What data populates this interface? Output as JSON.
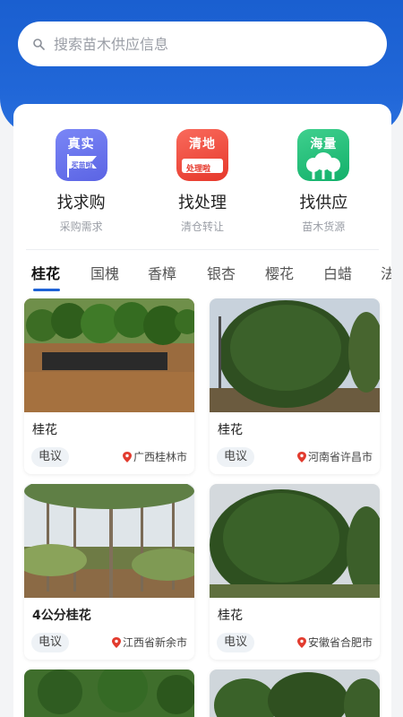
{
  "search": {
    "placeholder": "搜索苗木供应信息"
  },
  "quick_actions": [
    {
      "badge": "真实",
      "badge_sub": "买苗啦",
      "title": "找求购",
      "subtitle": "采购需求",
      "icon": "purchase-icon"
    },
    {
      "badge": "清地",
      "badge_sub": "处理啦",
      "title": "找处理",
      "subtitle": "清仓转让",
      "icon": "clearance-icon"
    },
    {
      "badge": "海量",
      "badge_sub": "",
      "title": "找供应",
      "subtitle": "苗木货源",
      "icon": "supply-tree-icon"
    }
  ],
  "tabs": [
    "桂花",
    "国槐",
    "香樟",
    "银杏",
    "樱花",
    "白蜡",
    "法"
  ],
  "active_tab": "桂花",
  "products": [
    {
      "name": "桂花",
      "price": "电议",
      "location": "广西桂林市"
    },
    {
      "name": "桂花",
      "price": "电议",
      "location": "河南省许昌市"
    },
    {
      "name": "4公分桂花",
      "price": "电议",
      "location": "江西省新余市"
    },
    {
      "name": "桂花",
      "price": "电议",
      "location": "安徽省合肥市"
    }
  ],
  "colors": {
    "primary": "#1f63d6",
    "header": "#2167d8",
    "background": "#f3f4f6"
  }
}
